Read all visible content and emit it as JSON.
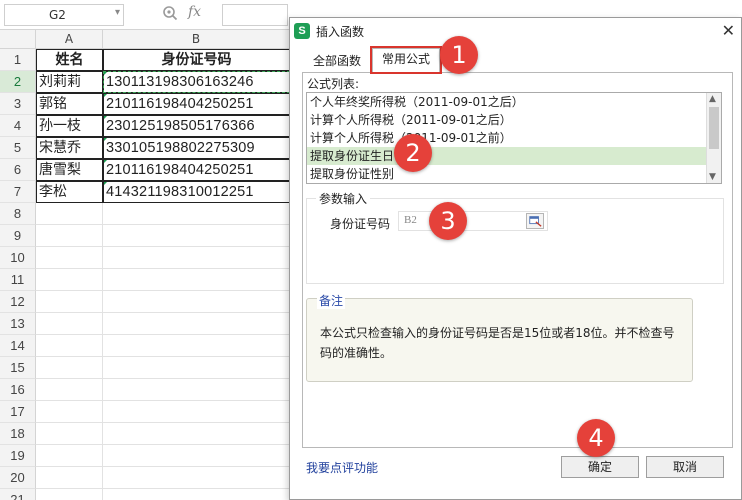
{
  "formula_bar": {
    "name_box": "G2",
    "fx_label": "fx"
  },
  "sheet": {
    "columns": [
      "A",
      "B"
    ],
    "rows": [
      "1",
      "2",
      "3",
      "4",
      "5",
      "6",
      "7",
      "8",
      "9",
      "10",
      "11",
      "12",
      "13",
      "14",
      "15",
      "16",
      "17",
      "18",
      "19",
      "20",
      "21"
    ],
    "header": {
      "name": "姓名",
      "id": "身份证号码"
    },
    "records": [
      {
        "name": "刘莉莉",
        "id": "130113198306163246"
      },
      {
        "name": "郭铭",
        "id": "210116198404250251"
      },
      {
        "name": "孙一枝",
        "id": "230125198505176366"
      },
      {
        "name": "宋慧乔",
        "id": "330105198802275309"
      },
      {
        "name": "唐雪梨",
        "id": "210116198404250251"
      },
      {
        "name": "李松",
        "id": "414321198310012251"
      }
    ]
  },
  "dialog": {
    "app_icon": "S",
    "title": "插入函数",
    "close": "✕",
    "tabs": [
      {
        "label": "全部函数"
      },
      {
        "label": "常用公式"
      }
    ],
    "list_label": "公式列表:",
    "formula_list": [
      "个人年终奖所得税（2011-09-01之后）",
      "计算个人所得税（2011-09-01之后）",
      "计算个人所得税（2011-09-01之前）",
      "提取身份证生日",
      "提取身份证性别"
    ],
    "params_label": "参数输入",
    "param_name": "身份证号码",
    "param_value": "B2",
    "notes_label": "备注",
    "notes_text": "本公式只检查输入的身份证号码是否是15位或者18位。并不检查号码的准确性。",
    "feedback_link": "我要点评功能",
    "ok_label": "确定",
    "cancel_label": "取消"
  },
  "badges": [
    "1",
    "2",
    "3",
    "4"
  ],
  "colors": {
    "badge": "#e5413a",
    "selection_green": "#3aa655",
    "list_selected": "#d7ebcf",
    "app_icon": "#1e9e55",
    "link": "#1f3f9c"
  }
}
